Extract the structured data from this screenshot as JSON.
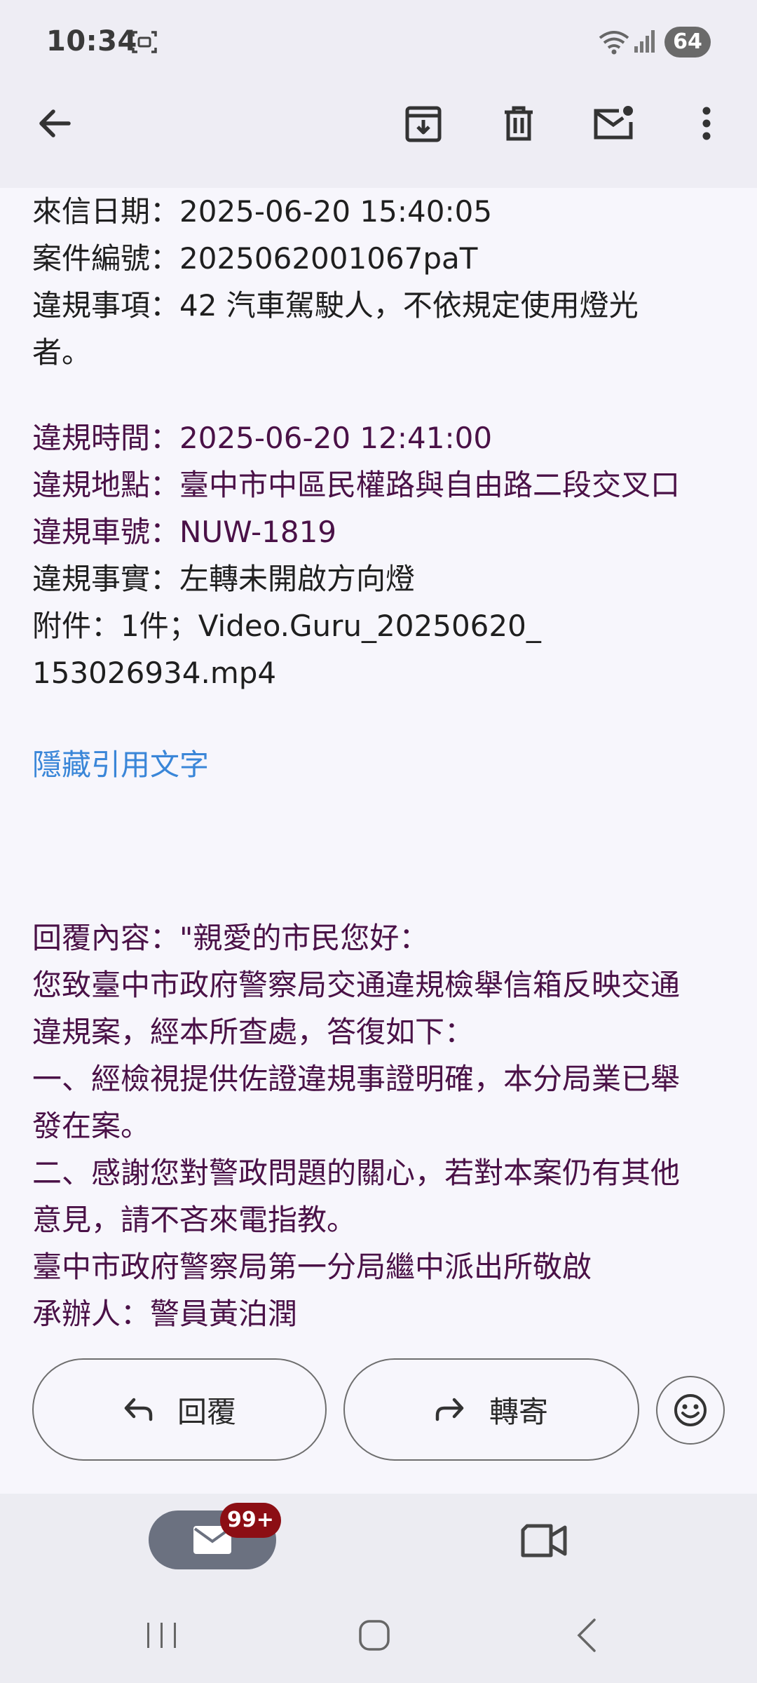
{
  "status": {
    "time": "10:34",
    "battery": "64",
    "icons": [
      "screenshot-icon",
      "wifi-icon",
      "signal-icon"
    ]
  },
  "toolbar": {
    "icons": [
      "back-arrow-icon",
      "archive-icon",
      "trash-icon",
      "mark-unread-icon",
      "more-vert-icon"
    ]
  },
  "email": {
    "lines": [
      "來信日期：2025-06-20 15:40:05",
      "案件編號：2025062001067paT",
      "違規事項：42 汽車駕駛人，不依規定使用燈光",
      "者。"
    ],
    "quoted_lines": [
      "違規時間：2025-06-20 12:41:00",
      "違規地點：臺中市中區民權路與自由路二段交叉口",
      "違規車號：NUW-1819"
    ],
    "more_lines": [
      "違規事實：左轉未開啟方向燈",
      "附件：1件；Video.Guru_20250620_",
      "153026934.mp4"
    ],
    "hide_quoted_link": "隱藏引用文字",
    "reply_lines": [
      "回覆內容：\"親愛的市民您好：",
      "您致臺中市政府警察局交通違規檢舉信箱反映交通",
      "違規案，經本所查處，答復如下：",
      "一、經檢視提供佐證違規事證明確，本分局業已舉",
      "發在案。",
      "二、感謝您對警政問題的關心，若對本案仍有其他",
      "意見，請不吝來電指教。",
      "臺中市政府警察局第一分局繼中派出所敬啟",
      "承辦人：警員黃泊潤"
    ]
  },
  "actions": {
    "reply": "回覆",
    "forward": "轉寄"
  },
  "nav": {
    "mail_badge": "99+"
  }
}
